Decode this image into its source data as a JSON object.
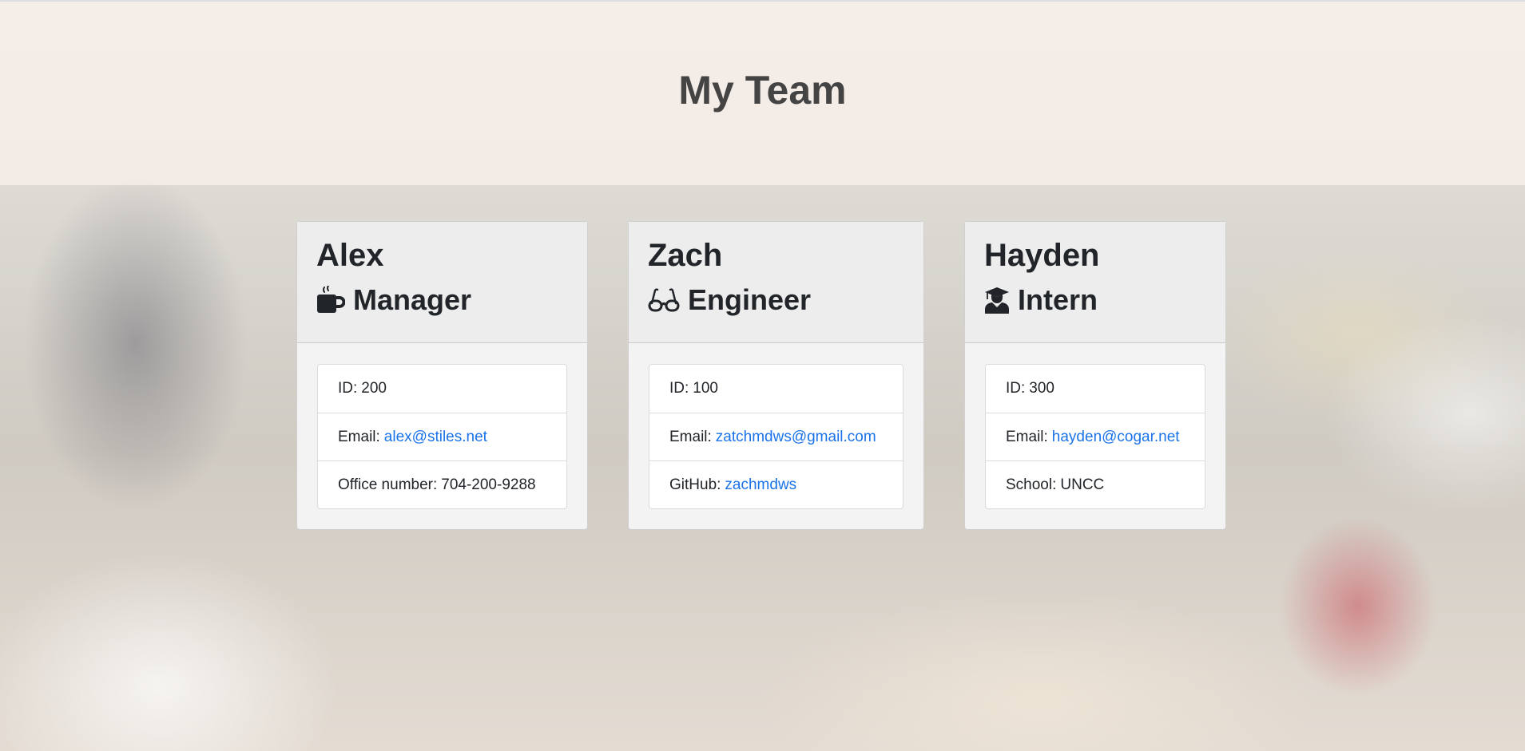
{
  "header": {
    "title": "My Team"
  },
  "team": [
    {
      "name": "Alex",
      "role": "Manager",
      "icon": "coffee-mug-icon",
      "id_label": "ID:",
      "id": "200",
      "email_label": "Email:",
      "email": "alex@stiles.net",
      "extra_label": "Office number:",
      "extra_value": "704-200-9288"
    },
    {
      "name": "Zach",
      "role": "Engineer",
      "icon": "glasses-icon",
      "id_label": "ID:",
      "id": "100",
      "email_label": "Email:",
      "email": "zatchmdws@gmail.com",
      "extra_label": "GitHub:",
      "extra_value": "zachmdws"
    },
    {
      "name": "Hayden",
      "role": "Intern",
      "icon": "graduate-icon",
      "id_label": "ID:",
      "id": "300",
      "email_label": "Email:",
      "email": "hayden@cogar.net",
      "extra_label": "School:",
      "extra_value": "UNCC"
    }
  ],
  "colors": {
    "link": "#1a73e8",
    "text": "#212529",
    "title": "#444444"
  }
}
